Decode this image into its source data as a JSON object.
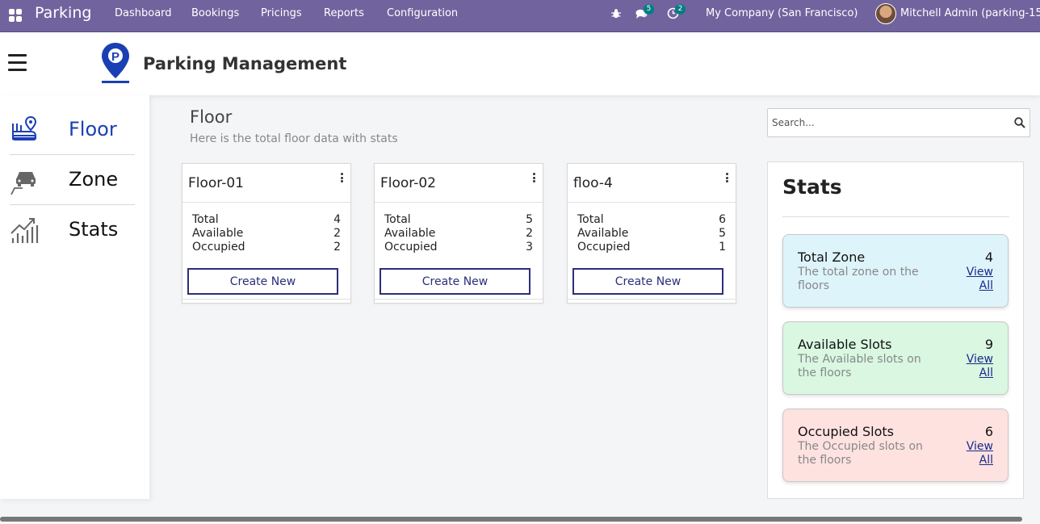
{
  "topbar": {
    "brand": "Parking",
    "menu": [
      "Dashboard",
      "Bookings",
      "Pricings",
      "Reports",
      "Configuration"
    ],
    "messages_badge": "5",
    "activity_badge": "2",
    "company": "My Company (San Francisco)",
    "user": "Mitchell Admin (parking-15)",
    "accent_color": "#71639e"
  },
  "header": {
    "title": "Parking Management",
    "logo_color": "#1a3fb5"
  },
  "sidebar": {
    "items": [
      {
        "label": "Floor",
        "icon": "floor-icon",
        "active": true
      },
      {
        "label": "Zone",
        "icon": "car-icon",
        "active": false
      },
      {
        "label": "Stats",
        "icon": "trending-chart-icon",
        "active": false
      }
    ]
  },
  "main": {
    "title": "Floor",
    "subtitle": "Here is the total floor data with stats",
    "search_placeholder": "Search...",
    "floors": [
      {
        "name": "Floor-01",
        "rows": [
          {
            "label": "Total",
            "value": "4"
          },
          {
            "label": "Available",
            "value": "2"
          },
          {
            "label": "Occupied",
            "value": "2"
          }
        ],
        "button": "Create New"
      },
      {
        "name": "Floor-02",
        "rows": [
          {
            "label": "Total",
            "value": "5"
          },
          {
            "label": "Available",
            "value": "2"
          },
          {
            "label": "Occupied",
            "value": "3"
          }
        ],
        "button": "Create New"
      },
      {
        "name": "floo-4",
        "rows": [
          {
            "label": "Total",
            "value": "6"
          },
          {
            "label": "Available",
            "value": "5"
          },
          {
            "label": "Occupied",
            "value": "1"
          }
        ],
        "button": "Create New"
      }
    ]
  },
  "stats": {
    "title": "Stats",
    "cards": [
      {
        "title": "Total Zone",
        "value": "4",
        "desc": "The total zone on the floors",
        "link_line1": "View",
        "link_line2": "All",
        "color": "#def4fb"
      },
      {
        "title": "Available Slots",
        "value": "9",
        "desc": "The Available slots on the floors",
        "link_line1": "View",
        "link_line2": "All",
        "color": "#d9f7e1"
      },
      {
        "title": "Occupied Slots",
        "value": "6",
        "desc": "The Occupied slots on the floors",
        "link_line1": "View",
        "link_line2": "All",
        "color": "#fde2e0"
      }
    ]
  }
}
